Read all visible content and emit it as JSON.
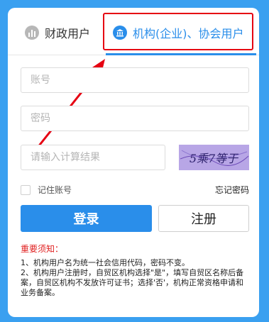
{
  "tabs": {
    "personal": {
      "label": "财政用户",
      "icon": "bar-chart-icon"
    },
    "organization": {
      "label": "机构(企业)、协会用户",
      "icon": "bank-building-icon",
      "active": true
    }
  },
  "form": {
    "account_placeholder": "账号",
    "password_placeholder": "密码",
    "captcha_placeholder": "请输入计算结果",
    "captcha_text": "5乘7等于"
  },
  "remember_label": "记住账号",
  "forgot_label": "忘记密码",
  "login_label": "登录",
  "register_label": "注册",
  "notice": {
    "title": "重要须知：",
    "items": [
      "1、机构用户名为统一社会信用代码，密码不变。",
      "2、机构用户注册时，自贸区机构选择\"是\"，填写自贸区名称后备案，自贸区机构不发放许可证书；选择'否'，机构正常资格申请和业务备案。"
    ]
  },
  "colors": {
    "background": "#3aa0f0",
    "accent": "#2a8eea",
    "highlight": "#e60012",
    "notice_title": "#e02020",
    "captcha_bg": "#b8a6e6"
  }
}
